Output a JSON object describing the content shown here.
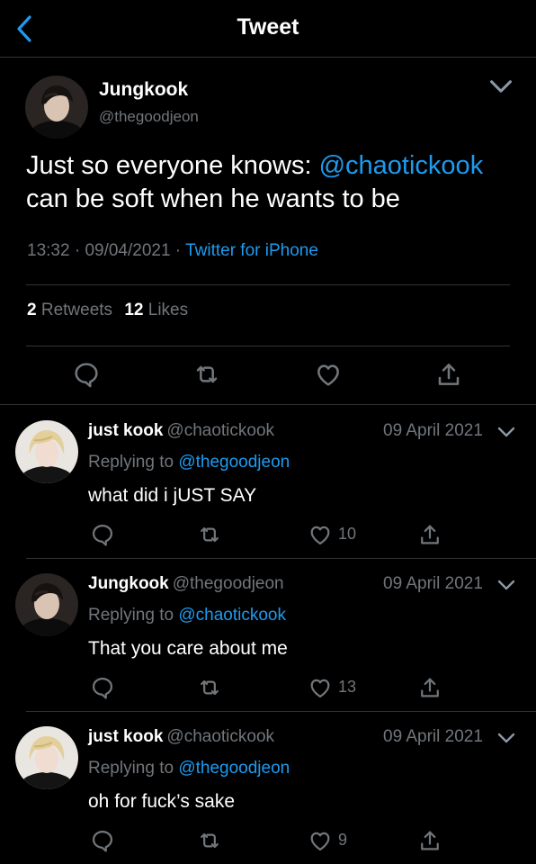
{
  "header": {
    "title": "Tweet",
    "back_icon": "chevron-left-icon"
  },
  "colors": {
    "background": "#000000",
    "text": "#ffffff",
    "muted": "#71767b",
    "accent": "#1d9bf0",
    "divider": "#2f3336"
  },
  "main_tweet": {
    "name": "Jungkook",
    "handle": "@thegoodjeon",
    "text_before": "Just so everyone knows: ",
    "mention": "@chaotickook",
    "text_after": " can be soft when he wants to be",
    "time": "13:32",
    "date": "09/04/2021",
    "separator": " · ",
    "source": "Twitter for iPhone",
    "retweet_count": "2",
    "retweet_label": "Retweets",
    "like_count": "12",
    "like_label": "Likes"
  },
  "replies": [
    {
      "name": "just kook",
      "handle": "@chaotickook",
      "date": "09 April 2021",
      "replying_prefix": "Replying to ",
      "replying_to": "@thegoodjeon",
      "text": "what did i jUST SAY",
      "likes": "10"
    },
    {
      "name": "Jungkook",
      "handle": "@thegoodjeon",
      "date": "09 April 2021",
      "replying_prefix": "Replying to ",
      "replying_to": "@chaotickook",
      "text": "That you care about me",
      "likes": "13"
    },
    {
      "name": "just kook",
      "handle": "@chaotickook",
      "date": "09 April 2021",
      "replying_prefix": "Replying to ",
      "replying_to": "@thegoodjeon",
      "text": "oh for fuck’s sake",
      "likes": "9"
    }
  ]
}
